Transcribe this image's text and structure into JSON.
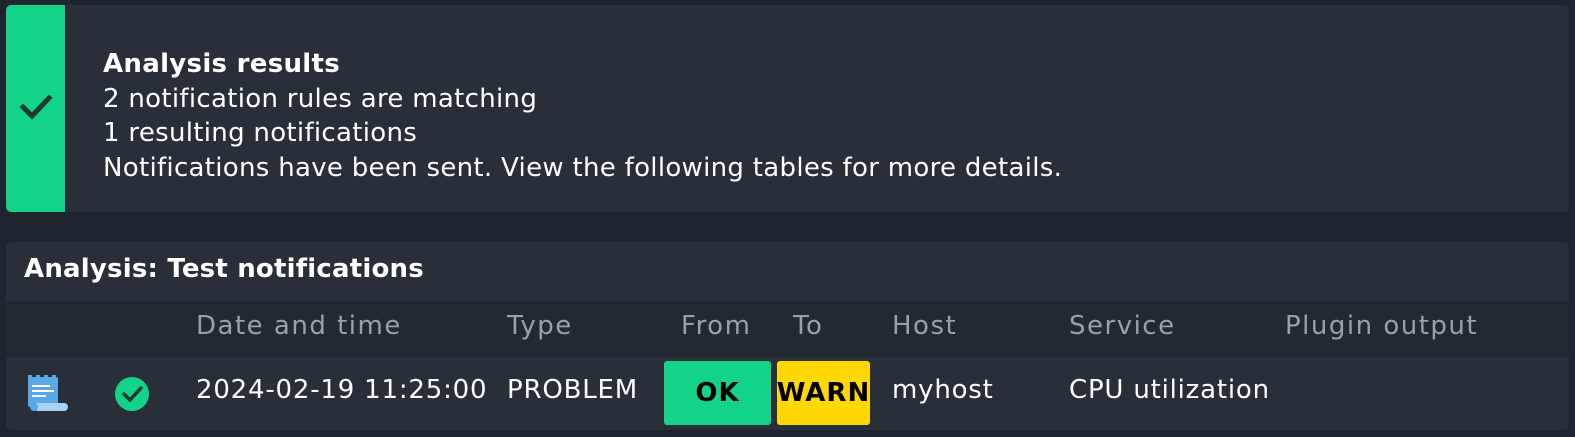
{
  "result": {
    "status_icon": "check-icon",
    "title": "Analysis results",
    "line1": "2 notification rules are matching",
    "line2": "1 resulting notifications",
    "line3": "Notifications have been sent. View the following tables for more details.",
    "accent_color": "#13d389"
  },
  "analysis": {
    "title": "Analysis: Test notifications",
    "columns": {
      "date": "Date and time",
      "type": "Type",
      "from": "From",
      "to": "To",
      "host": "Host",
      "service": "Service",
      "plugin_output": "Plugin output"
    },
    "row": {
      "log_icon": "notification-log-icon",
      "status_icon": "success-check-icon",
      "date": "2024-02-19 11:25:00",
      "type": "PROBLEM",
      "from": "OK",
      "to": "WARN",
      "host": "myhost",
      "service": "CPU utilization",
      "plugin_output": "",
      "from_color": "#13d389",
      "to_color": "#ffd703"
    }
  }
}
